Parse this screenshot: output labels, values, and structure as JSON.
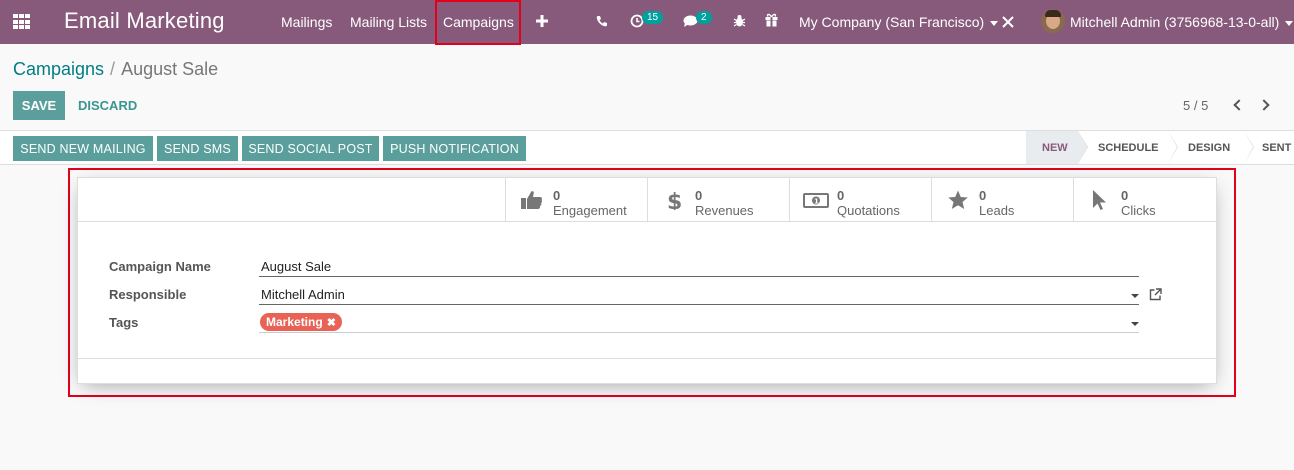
{
  "app": {
    "title": "Email Marketing"
  },
  "nav": {
    "menu": [
      "Mailings",
      "Mailing Lists",
      "Campaigns"
    ],
    "active": "Campaigns",
    "activity_count": "15",
    "message_count": "2",
    "company": "My Company (San Francisco)",
    "user": "Mitchell Admin (3756968-13-0-all)"
  },
  "breadcrumb": {
    "parent": "Campaigns",
    "separator": "/",
    "current": "August Sale"
  },
  "actions": {
    "save": "SAVE",
    "discard": "DISCARD"
  },
  "pager": {
    "value": "5 / 5"
  },
  "buttons": [
    "SEND NEW MAILING",
    "SEND SMS",
    "SEND SOCIAL POST",
    "PUSH NOTIFICATION"
  ],
  "stages": [
    "NEW",
    "SCHEDULE",
    "DESIGN",
    "SENT"
  ],
  "active_stage": "NEW",
  "stats": [
    {
      "value": "0",
      "label": "Engagement",
      "icon": "thumbs-up-icon"
    },
    {
      "value": "0",
      "label": "Revenues",
      "icon": "dollar-icon"
    },
    {
      "value": "0",
      "label": "Quotations",
      "icon": "money-icon"
    },
    {
      "value": "0",
      "label": "Leads",
      "icon": "star-icon"
    },
    {
      "value": "0",
      "label": "Clicks",
      "icon": "cursor-icon"
    }
  ],
  "form": {
    "campaign_name_label": "Campaign Name",
    "campaign_name": "August Sale",
    "responsible_label": "Responsible",
    "responsible": "Mitchell Admin",
    "tags_label": "Tags",
    "tags": [
      "Marketing"
    ]
  },
  "colors": {
    "navbar": "#875a7b",
    "primary": "#5a9f9c",
    "tag": "#e86255",
    "highlight": "#e3001b"
  }
}
